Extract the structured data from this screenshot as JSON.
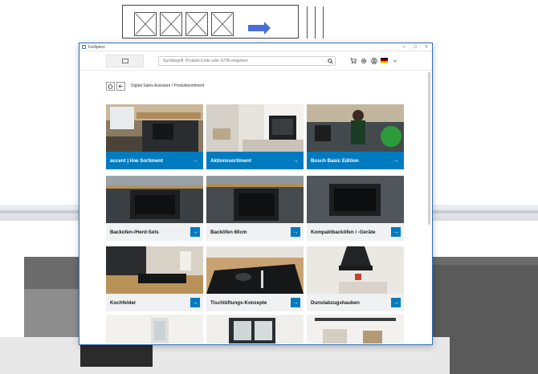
{
  "window": {
    "title": "IceSpecs"
  },
  "header": {
    "search_placeholder": "Suchbegriff, Produkt-Code oder GTIN eingeben"
  },
  "breadcrumb": "Digital Sales Assistant / Produktsortiment",
  "cards": [
    {
      "label": "accent | line Sortiment",
      "style": "blue"
    },
    {
      "label": "Aktionssortiment",
      "style": "blue"
    },
    {
      "label": "Bosch Basic Edition",
      "style": "blue"
    },
    {
      "label": "Backofen-/Herd-Sets",
      "style": "gray"
    },
    {
      "label": "Backöfen 60cm",
      "style": "gray"
    },
    {
      "label": "Kompaktbacköfen / -Geräte",
      "style": "gray"
    },
    {
      "label": "Kochfelder",
      "style": "gray"
    },
    {
      "label": "Tischlüftungs-Konzepte",
      "style": "gray"
    },
    {
      "label": "Dunstabzugshauben",
      "style": "gray"
    }
  ],
  "colors": {
    "accent_blue": "#007bc0",
    "card_gray": "#eff1f2"
  },
  "icons": {
    "arrow": "→",
    "search": "search-icon",
    "cart": "cart-icon",
    "settings": "gear-icon",
    "account": "user-icon",
    "language": "flag-de-icon"
  }
}
